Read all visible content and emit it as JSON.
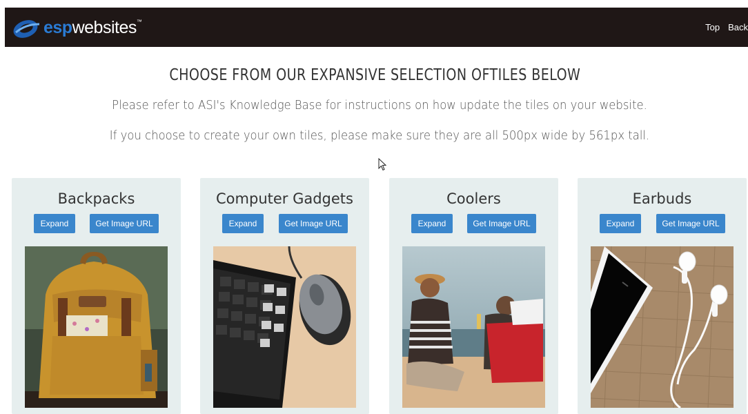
{
  "brand": {
    "esp": "esp",
    "websites": "websites",
    "tm": "™"
  },
  "nav": {
    "links": [
      "Top",
      "Back"
    ]
  },
  "headline": "CHOOSE FROM OUR EXPANSIVE SELECTION OFTILES BELOW",
  "sub1": "Please refer to ASI's Knowledge Base for instructions on how update the tiles on your website.",
  "sub2": "If you choose to create your own tiles, please make sure they are all 500px wide by 561px tall.",
  "buttons": {
    "expand": "Expand",
    "get_url": "Get Image URL"
  },
  "tiles": [
    {
      "title": "Backpacks",
      "image": "backpack-photo"
    },
    {
      "title": "Computer Gadgets",
      "image": "keyboard-mouse-photo"
    },
    {
      "title": "Coolers",
      "image": "beach-cooler-photo"
    },
    {
      "title": "Earbuds",
      "image": "phone-earbuds-photo"
    }
  ],
  "colors": {
    "navbar": "#1f1716",
    "accent": "#3a86cc",
    "tile_bg": "#e6eeee",
    "logo_blue": "#2a7bd4"
  }
}
